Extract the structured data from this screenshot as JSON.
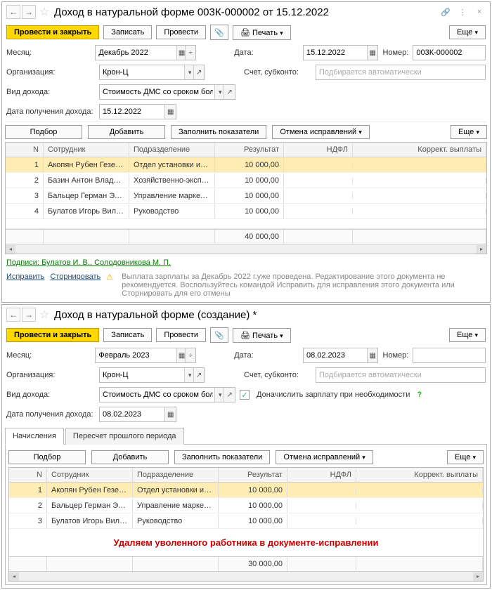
{
  "doc1": {
    "title": "Доход в натуральной форме 003К-000002 от 15.12.2022",
    "nav_back": "←",
    "nav_fwd": "→",
    "star": "☆",
    "link_icon": "🔗",
    "menu_icon": "⋮",
    "close_icon": "×",
    "btn_post_close": "Провести и закрыть",
    "btn_write": "Записать",
    "btn_post": "Провести",
    "attach_icon": "📎",
    "print_icon": "🖨",
    "btn_print": "Печать",
    "btn_more": "Еще",
    "lbl_month": "Месяц:",
    "month_val": "Декабрь 2022",
    "lbl_date": "Дата:",
    "date_val": "15.12.2022",
    "lbl_number": "Номер:",
    "number_val": "003К-000002",
    "lbl_org": "Организация:",
    "org_val": "Крон-Ц",
    "lbl_account": "Счет, субконто:",
    "account_ph": "Подбирается автоматически",
    "lbl_income_type": "Вид дохода:",
    "income_type_val": "Стоимость ДМС со сроком бол",
    "lbl_receipt_date": "Дата получения дохода:",
    "receipt_date_val": "15.12.2022",
    "btn_pick": "Подбор",
    "btn_add": "Добавить",
    "btn_fill": "Заполнить показатели",
    "btn_cancel_corr": "Отмена исправлений",
    "cols": {
      "n": "N",
      "emp": "Сотрудник",
      "dept": "Подразделение",
      "res": "Результат",
      "ndfl": "НДФЛ",
      "corr": "Коррект. выплаты"
    },
    "rows": [
      {
        "n": "1",
        "emp": "Акопян Рубен Гезевич",
        "dept": "Отдел установки и э...",
        "res": "10 000,00",
        "ndfl": "",
        "corr": ""
      },
      {
        "n": "2",
        "emp": "Базин Антон Владим...",
        "dept": "Хозяйственно-эксплу...",
        "res": "10 000,00",
        "ndfl": "",
        "corr": ""
      },
      {
        "n": "3",
        "emp": "Бальцер Герман Эду...",
        "dept": "Управление маркети...",
        "res": "10 000,00",
        "ndfl": "",
        "corr": ""
      },
      {
        "n": "4",
        "emp": "Булатов Игорь Виле...",
        "dept": "Руководство",
        "res": "10 000,00",
        "ndfl": "",
        "corr": ""
      }
    ],
    "total": "40 000,00",
    "signatures_label": "Подписи:",
    "signatures": "Булатов И. В., Солодовникова М. П.",
    "link_correct": "Исправить",
    "link_storno": "Сторнировать",
    "warning": "Выплата зарплаты за Декабрь 2022 г.уже проведена. Редактирование этого документа не рекомендуется. Воспользуйтесь командой Исправить для исправления этого документа или Сторнировать для его отмены"
  },
  "doc2": {
    "title": "Доход в натуральной форме (создание) *",
    "nav_back": "←",
    "nav_fwd": "→",
    "star": "☆",
    "btn_post_close": "Провести и закрыть",
    "btn_write": "Записать",
    "btn_post": "Провести",
    "attach_icon": "📎",
    "print_icon": "🖨",
    "btn_print": "Печать",
    "btn_more": "Еще",
    "lbl_month": "Месяц:",
    "month_val": "Февраль 2023",
    "lbl_date": "Дата:",
    "date_val": "08.02.2023",
    "lbl_number": "Номер:",
    "number_val": "",
    "lbl_org": "Организация:",
    "org_val": "Крон-Ц",
    "lbl_account": "Счет, субконто:",
    "account_ph": "Подбирается автоматически",
    "lbl_income_type": "Вид дохода:",
    "income_type_val": "Стоимость ДМС со сроком болеее",
    "checkbox_label": "Доначислить зарплату при необходимости",
    "lbl_receipt_date": "Дата получения дохода:",
    "receipt_date_val": "08.02.2023",
    "tab1": "Начисления",
    "tab2": "Пересчет прошлого периода",
    "btn_pick": "Подбор",
    "btn_add": "Добавить",
    "btn_fill": "Заполнить показатели",
    "btn_cancel_corr": "Отмена исправлений",
    "cols": {
      "n": "N",
      "emp": "Сотрудник",
      "dept": "Подразделение",
      "res": "Результат",
      "ndfl": "НДФЛ",
      "corr": "Коррект. выплаты"
    },
    "rows": [
      {
        "n": "1",
        "emp": "Акопян Рубен Гезевич",
        "dept": "Отдел установки и э...",
        "res": "10 000,00",
        "ndfl": "",
        "corr": ""
      },
      {
        "n": "2",
        "emp": "Бальцер Герман Эду...",
        "dept": "Управление маркети...",
        "res": "10 000,00",
        "ndfl": "",
        "corr": ""
      },
      {
        "n": "3",
        "emp": "Булатов Игорь Виле...",
        "dept": "Руководство",
        "res": "10 000,00",
        "ndfl": "",
        "corr": ""
      }
    ],
    "red_note": "Удаляем уволенного работника в документе-исправлении",
    "total": "30 000,00"
  }
}
